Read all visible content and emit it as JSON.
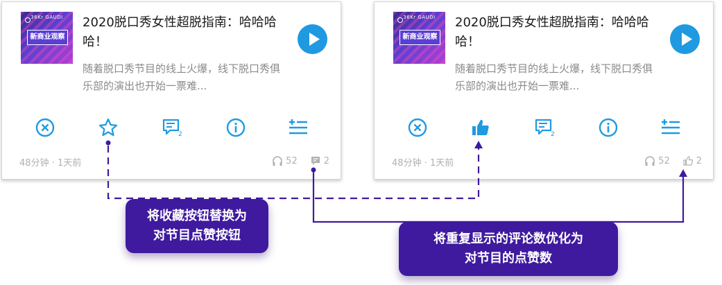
{
  "colors": {
    "accent": "#1f9ae0",
    "callout": "#3f1a9e",
    "connector": "#3f1a9e"
  },
  "cover": {
    "brand": "36Kr GAUDI",
    "badge": "新商业观察"
  },
  "cards": [
    {
      "variant": "before",
      "title": "2020脱口秀女性超脱指南：哈哈哈哈！",
      "description": "随着脱口秀节目的线上火爆，线下脱口秀俱乐部的演出也开始一票难...",
      "actions": [
        "close-icon",
        "star-icon",
        "comment-icon",
        "info-icon",
        "add-to-playlist-icon"
      ],
      "comment_badge": "2",
      "meta": "48分钟 · 1天前",
      "listen_count": "52",
      "second_stat": "2",
      "second_stat_icon": "comment-icon"
    },
    {
      "variant": "after",
      "title": "2020脱口秀女性超脱指南：哈哈哈哈！",
      "description": "随着脱口秀节目的线上火爆，线下脱口秀俱乐部的演出也开始一票难...",
      "actions": [
        "close-icon",
        "thumbs-up-icon",
        "comment-icon",
        "info-icon",
        "add-to-playlist-icon"
      ],
      "comment_badge": "2",
      "meta": "48分钟 · 1天前",
      "listen_count": "52",
      "second_stat": "2",
      "second_stat_icon": "thumbs-up-icon"
    }
  ],
  "callouts": [
    {
      "line1": "将收藏按钮替换为",
      "line2": "对节目点赞按钮"
    },
    {
      "line1": "将重复显示的评论数优化为",
      "line2": "对节目的点赞数"
    }
  ]
}
